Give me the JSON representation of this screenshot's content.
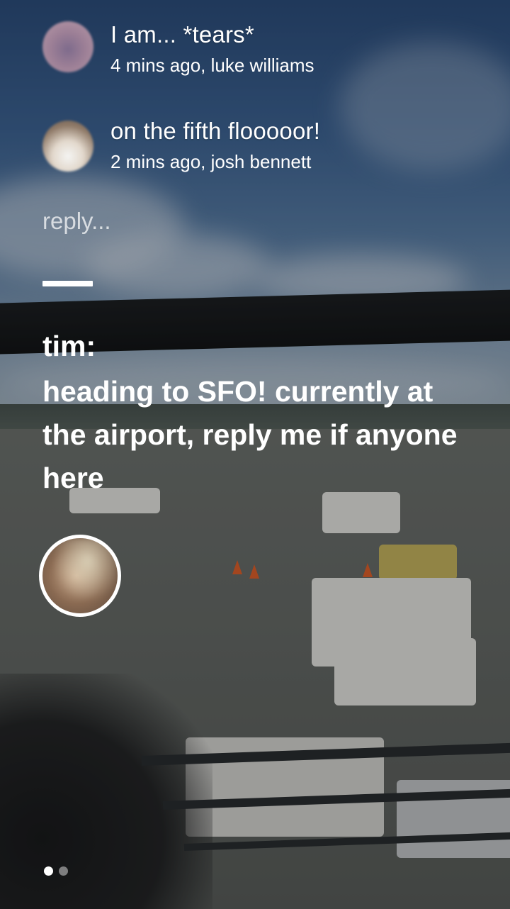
{
  "comments": [
    {
      "text": "I am... *tears*",
      "time": "4 mins ago",
      "author": "luke williams",
      "meta": "4 mins ago, luke williams"
    },
    {
      "text": "on the fifth flooooor!",
      "time": "2 mins ago",
      "author": "josh bennett",
      "meta": "2 mins ago, josh bennett"
    }
  ],
  "reply": {
    "placeholder": "reply..."
  },
  "post": {
    "author_label": "tim:",
    "text": "heading to SFO! currently at the airport, reply me if anyone here"
  },
  "pagination": {
    "total": 2,
    "current": 1
  },
  "colors": {
    "text": "#ffffff",
    "avatar_ring": "#ffffff"
  },
  "icons": {
    "comment_avatar_1": "avatar-luke-williams",
    "comment_avatar_2": "avatar-josh-bennett",
    "author_avatar": "avatar-tim"
  }
}
